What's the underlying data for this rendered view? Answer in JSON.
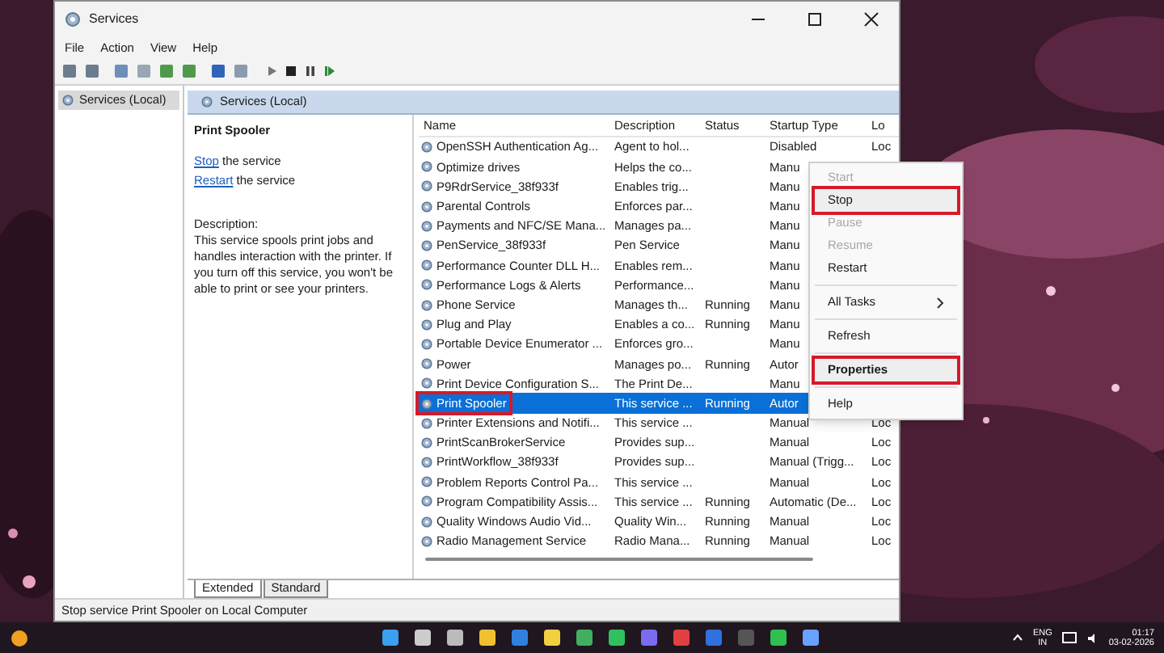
{
  "window": {
    "title": "Services"
  },
  "menu": [
    "File",
    "Action",
    "View",
    "Help"
  ],
  "tree": [
    {
      "label": "Services (Local)",
      "selected": true
    }
  ],
  "pane_header": "Services (Local)",
  "detail": {
    "title": "Print Spooler",
    "actions": [
      {
        "link": "Stop",
        "text": "the service"
      },
      {
        "link": "Restart",
        "text": "the service"
      }
    ],
    "description_label": "Description:",
    "description": "This service spools print jobs and handles interaction with the printer. If you turn off this service, you won't be able to print or see your printers."
  },
  "table": {
    "columns": [
      "Name",
      "Description",
      "Status",
      "Startup Type",
      "Lo"
    ],
    "rows": [
      {
        "name": "OpenSSH Authentication Ag...",
        "description": "Agent to hol...",
        "status": "",
        "startup": "Disabled",
        "logon": "Loc",
        "selected": false,
        "highlighted": false
      },
      {
        "name": "Optimize drives",
        "description": "Helps the co...",
        "status": "",
        "startup": "Manu",
        "logon": "",
        "selected": false,
        "highlighted": false
      },
      {
        "name": "P9RdrService_38f933f",
        "description": "Enables trig...",
        "status": "",
        "startup": "Manu",
        "logon": "",
        "selected": false,
        "highlighted": false
      },
      {
        "name": "Parental Controls",
        "description": "Enforces par...",
        "status": "",
        "startup": "Manu",
        "logon": "",
        "selected": false,
        "highlighted": false
      },
      {
        "name": "Payments and NFC/SE Mana...",
        "description": "Manages pa...",
        "status": "",
        "startup": "Manu",
        "logon": "",
        "selected": false,
        "highlighted": false
      },
      {
        "name": "PenService_38f933f",
        "description": "Pen Service",
        "status": "",
        "startup": "Manu",
        "logon": "",
        "selected": false,
        "highlighted": false
      },
      {
        "name": "Performance Counter DLL H...",
        "description": "Enables rem...",
        "status": "",
        "startup": "Manu",
        "logon": "",
        "selected": false,
        "highlighted": false
      },
      {
        "name": "Performance Logs & Alerts",
        "description": "Performance...",
        "status": "",
        "startup": "Manu",
        "logon": "",
        "selected": false,
        "highlighted": false
      },
      {
        "name": "Phone Service",
        "description": "Manages th...",
        "status": "Running",
        "startup": "Manu",
        "logon": "",
        "selected": false,
        "highlighted": false
      },
      {
        "name": "Plug and Play",
        "description": "Enables a co...",
        "status": "Running",
        "startup": "Manu",
        "logon": "",
        "selected": false,
        "highlighted": false
      },
      {
        "name": "Portable Device Enumerator ...",
        "description": "Enforces gro...",
        "status": "",
        "startup": "Manu",
        "logon": "",
        "selected": false,
        "highlighted": false
      },
      {
        "name": "Power",
        "description": "Manages po...",
        "status": "Running",
        "startup": "Autor",
        "logon": "",
        "selected": false,
        "highlighted": false
      },
      {
        "name": "Print Device Configuration S...",
        "description": "The Print De...",
        "status": "",
        "startup": "Manu",
        "logon": "",
        "selected": false,
        "highlighted": false
      },
      {
        "name": "Print Spooler",
        "description": "This service ...",
        "status": "Running",
        "startup": "Autor",
        "logon": "",
        "selected": true,
        "highlighted": true
      },
      {
        "name": "Printer Extensions and Notifi...",
        "description": "This service ...",
        "status": "",
        "startup": "Manual",
        "logon": "Loc",
        "selected": false,
        "highlighted": false
      },
      {
        "name": "PrintScanBrokerService",
        "description": "Provides sup...",
        "status": "",
        "startup": "Manual",
        "logon": "Loc",
        "selected": false,
        "highlighted": false
      },
      {
        "name": "PrintWorkflow_38f933f",
        "description": "Provides sup...",
        "status": "",
        "startup": "Manual (Trigg...",
        "logon": "Loc",
        "selected": false,
        "highlighted": false
      },
      {
        "name": "Problem Reports Control Pa...",
        "description": "This service ...",
        "status": "",
        "startup": "Manual",
        "logon": "Loc",
        "selected": false,
        "highlighted": false
      },
      {
        "name": "Program Compatibility Assis...",
        "description": "This service ...",
        "status": "Running",
        "startup": "Automatic (De...",
        "logon": "Loc",
        "selected": false,
        "highlighted": false
      },
      {
        "name": "Quality Windows Audio Vid...",
        "description": "Quality Win...",
        "status": "Running",
        "startup": "Manual",
        "logon": "Loc",
        "selected": false,
        "highlighted": false
      },
      {
        "name": "Radio Management Service",
        "description": "Radio Mana...",
        "status": "Running",
        "startup": "Manual",
        "logon": "Loc",
        "selected": false,
        "highlighted": false
      }
    ]
  },
  "context_menu": [
    {
      "kind": "item",
      "label": "Start",
      "disabled": true,
      "highlighted": false,
      "bold": false
    },
    {
      "kind": "item",
      "label": "Stop",
      "disabled": false,
      "highlighted": true,
      "bold": false
    },
    {
      "kind": "item",
      "label": "Pause",
      "disabled": true,
      "highlighted": false,
      "bold": false
    },
    {
      "kind": "item",
      "label": "Resume",
      "disabled": true,
      "highlighted": false,
      "bold": false
    },
    {
      "kind": "item",
      "label": "Restart",
      "disabled": false,
      "highlighted": false,
      "bold": false
    },
    {
      "kind": "separator"
    },
    {
      "kind": "submenu",
      "label": "All Tasks",
      "disabled": false,
      "highlighted": false,
      "bold": false
    },
    {
      "kind": "separator"
    },
    {
      "kind": "item",
      "label": "Refresh",
      "disabled": false,
      "highlighted": false,
      "bold": false
    },
    {
      "kind": "separator"
    },
    {
      "kind": "item",
      "label": "Properties",
      "disabled": false,
      "highlighted": true,
      "bold": true
    },
    {
      "kind": "separator"
    },
    {
      "kind": "item",
      "label": "Help",
      "disabled": false,
      "highlighted": false,
      "bold": false
    }
  ],
  "tabs": [
    {
      "label": "Extended",
      "selected": true
    },
    {
      "label": "Standard",
      "selected": false
    }
  ],
  "status_bar": "Stop service Print Spooler on Local Computer",
  "taskbar": {
    "language": "ENG",
    "region": "IN",
    "time": "01:17",
    "date": "03-02-2026"
  }
}
